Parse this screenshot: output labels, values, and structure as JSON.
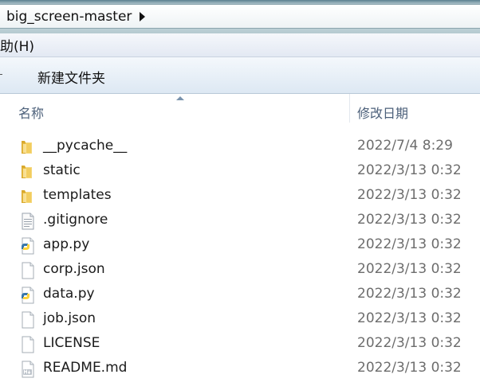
{
  "address": {
    "path_segment": "big_screen-master"
  },
  "menubar": {
    "help_label": "助(H)"
  },
  "toolbar": {
    "new_folder_label": "新建文件夹"
  },
  "columns": {
    "name_header": "名称",
    "date_header": "修改日期"
  },
  "files": [
    {
      "name": "__pycache__",
      "date": "2022/7/4 8:29",
      "icon": "folder-icon"
    },
    {
      "name": "static",
      "date": "2022/3/13 0:32",
      "icon": "folder-icon"
    },
    {
      "name": "templates",
      "date": "2022/3/13 0:32",
      "icon": "folder-icon"
    },
    {
      "name": ".gitignore",
      "date": "2022/3/13 0:32",
      "icon": "text-file-icon"
    },
    {
      "name": "app.py",
      "date": "2022/3/13 0:32",
      "icon": "python-file-icon"
    },
    {
      "name": "corp.json",
      "date": "2022/3/13 0:32",
      "icon": "blank-file-icon"
    },
    {
      "name": "data.py",
      "date": "2022/3/13 0:32",
      "icon": "python-file-icon"
    },
    {
      "name": "job.json",
      "date": "2022/3/13 0:32",
      "icon": "blank-file-icon"
    },
    {
      "name": "LICENSE",
      "date": "2022/3/13 0:32",
      "icon": "blank-file-icon"
    },
    {
      "name": "README.md",
      "date": "2022/3/13 0:32",
      "icon": "markdown-file-icon"
    }
  ]
}
